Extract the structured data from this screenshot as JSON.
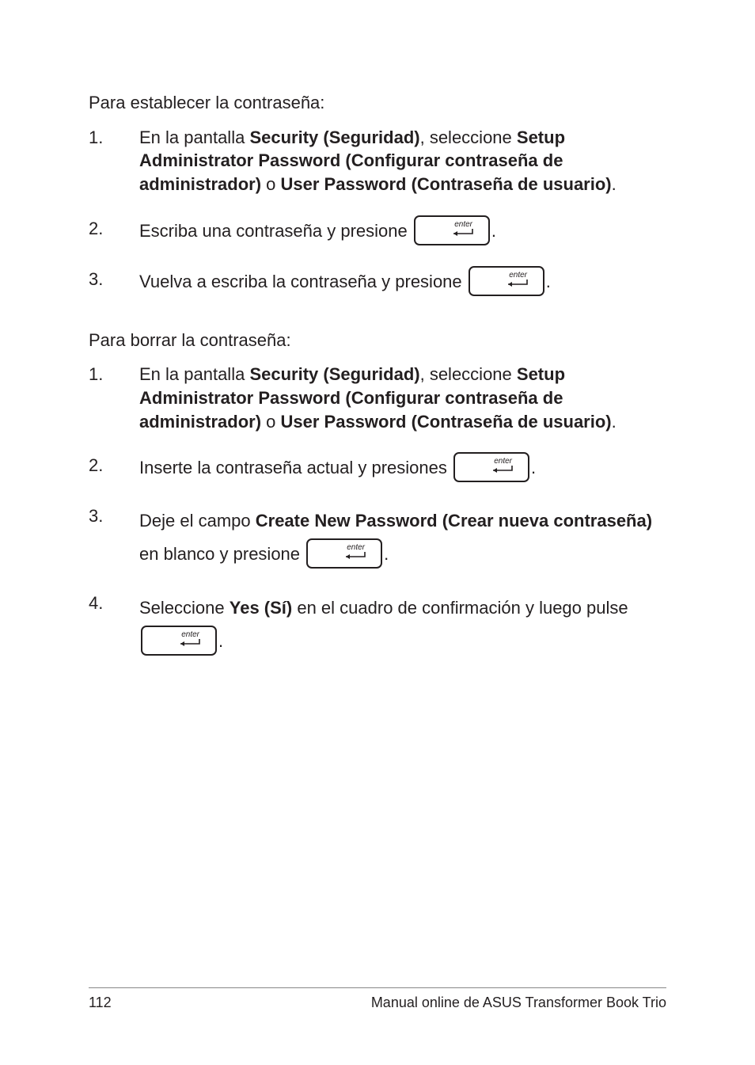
{
  "section1": {
    "heading": "Para establecer la contraseña:",
    "items": [
      {
        "num": "1.",
        "frag1": "En la pantalla ",
        "bold1": "Security (Seguridad)",
        "frag2": ", seleccione ",
        "bold2": "Setup Administrator Password (Configurar contraseña de administrador)",
        "frag3": " o ",
        "bold3": "User Password (Contraseña de usuario)",
        "frag4": "."
      },
      {
        "num": "2.",
        "frag1": "Escriba una contraseña y presione ",
        "frag2": "."
      },
      {
        "num": "3.",
        "frag1": "Vuelva a escriba la contraseña y presione ",
        "frag2": "."
      }
    ]
  },
  "section2": {
    "heading": "Para borrar la contraseña:",
    "items": [
      {
        "num": "1.",
        "frag1": "En la pantalla ",
        "bold1": "Security (Seguridad)",
        "frag2": ", seleccione ",
        "bold2": "Setup Administrator Password (Configurar contraseña de administrador)",
        "frag3": " o ",
        "bold3": "User Password (Contraseña de usuario)",
        "frag4": "."
      },
      {
        "num": "2.",
        "frag1": "Inserte la contraseña actual y presiones ",
        "frag2": "."
      },
      {
        "num": "3.",
        "frag1": "Deje el campo ",
        "bold1": "Create New Password (Crear nueva contraseña)",
        "frag2": " en blanco y presione ",
        "frag3": "."
      },
      {
        "num": "4.",
        "frag1": "Seleccione ",
        "bold1": "Yes (Sí)",
        "frag2": " en el cuadro de confirmación y luego pulse ",
        "frag3": "."
      }
    ]
  },
  "key_label": "enter",
  "footer": {
    "page_num": "112",
    "title": "Manual online de ASUS Transformer Book Trio"
  }
}
